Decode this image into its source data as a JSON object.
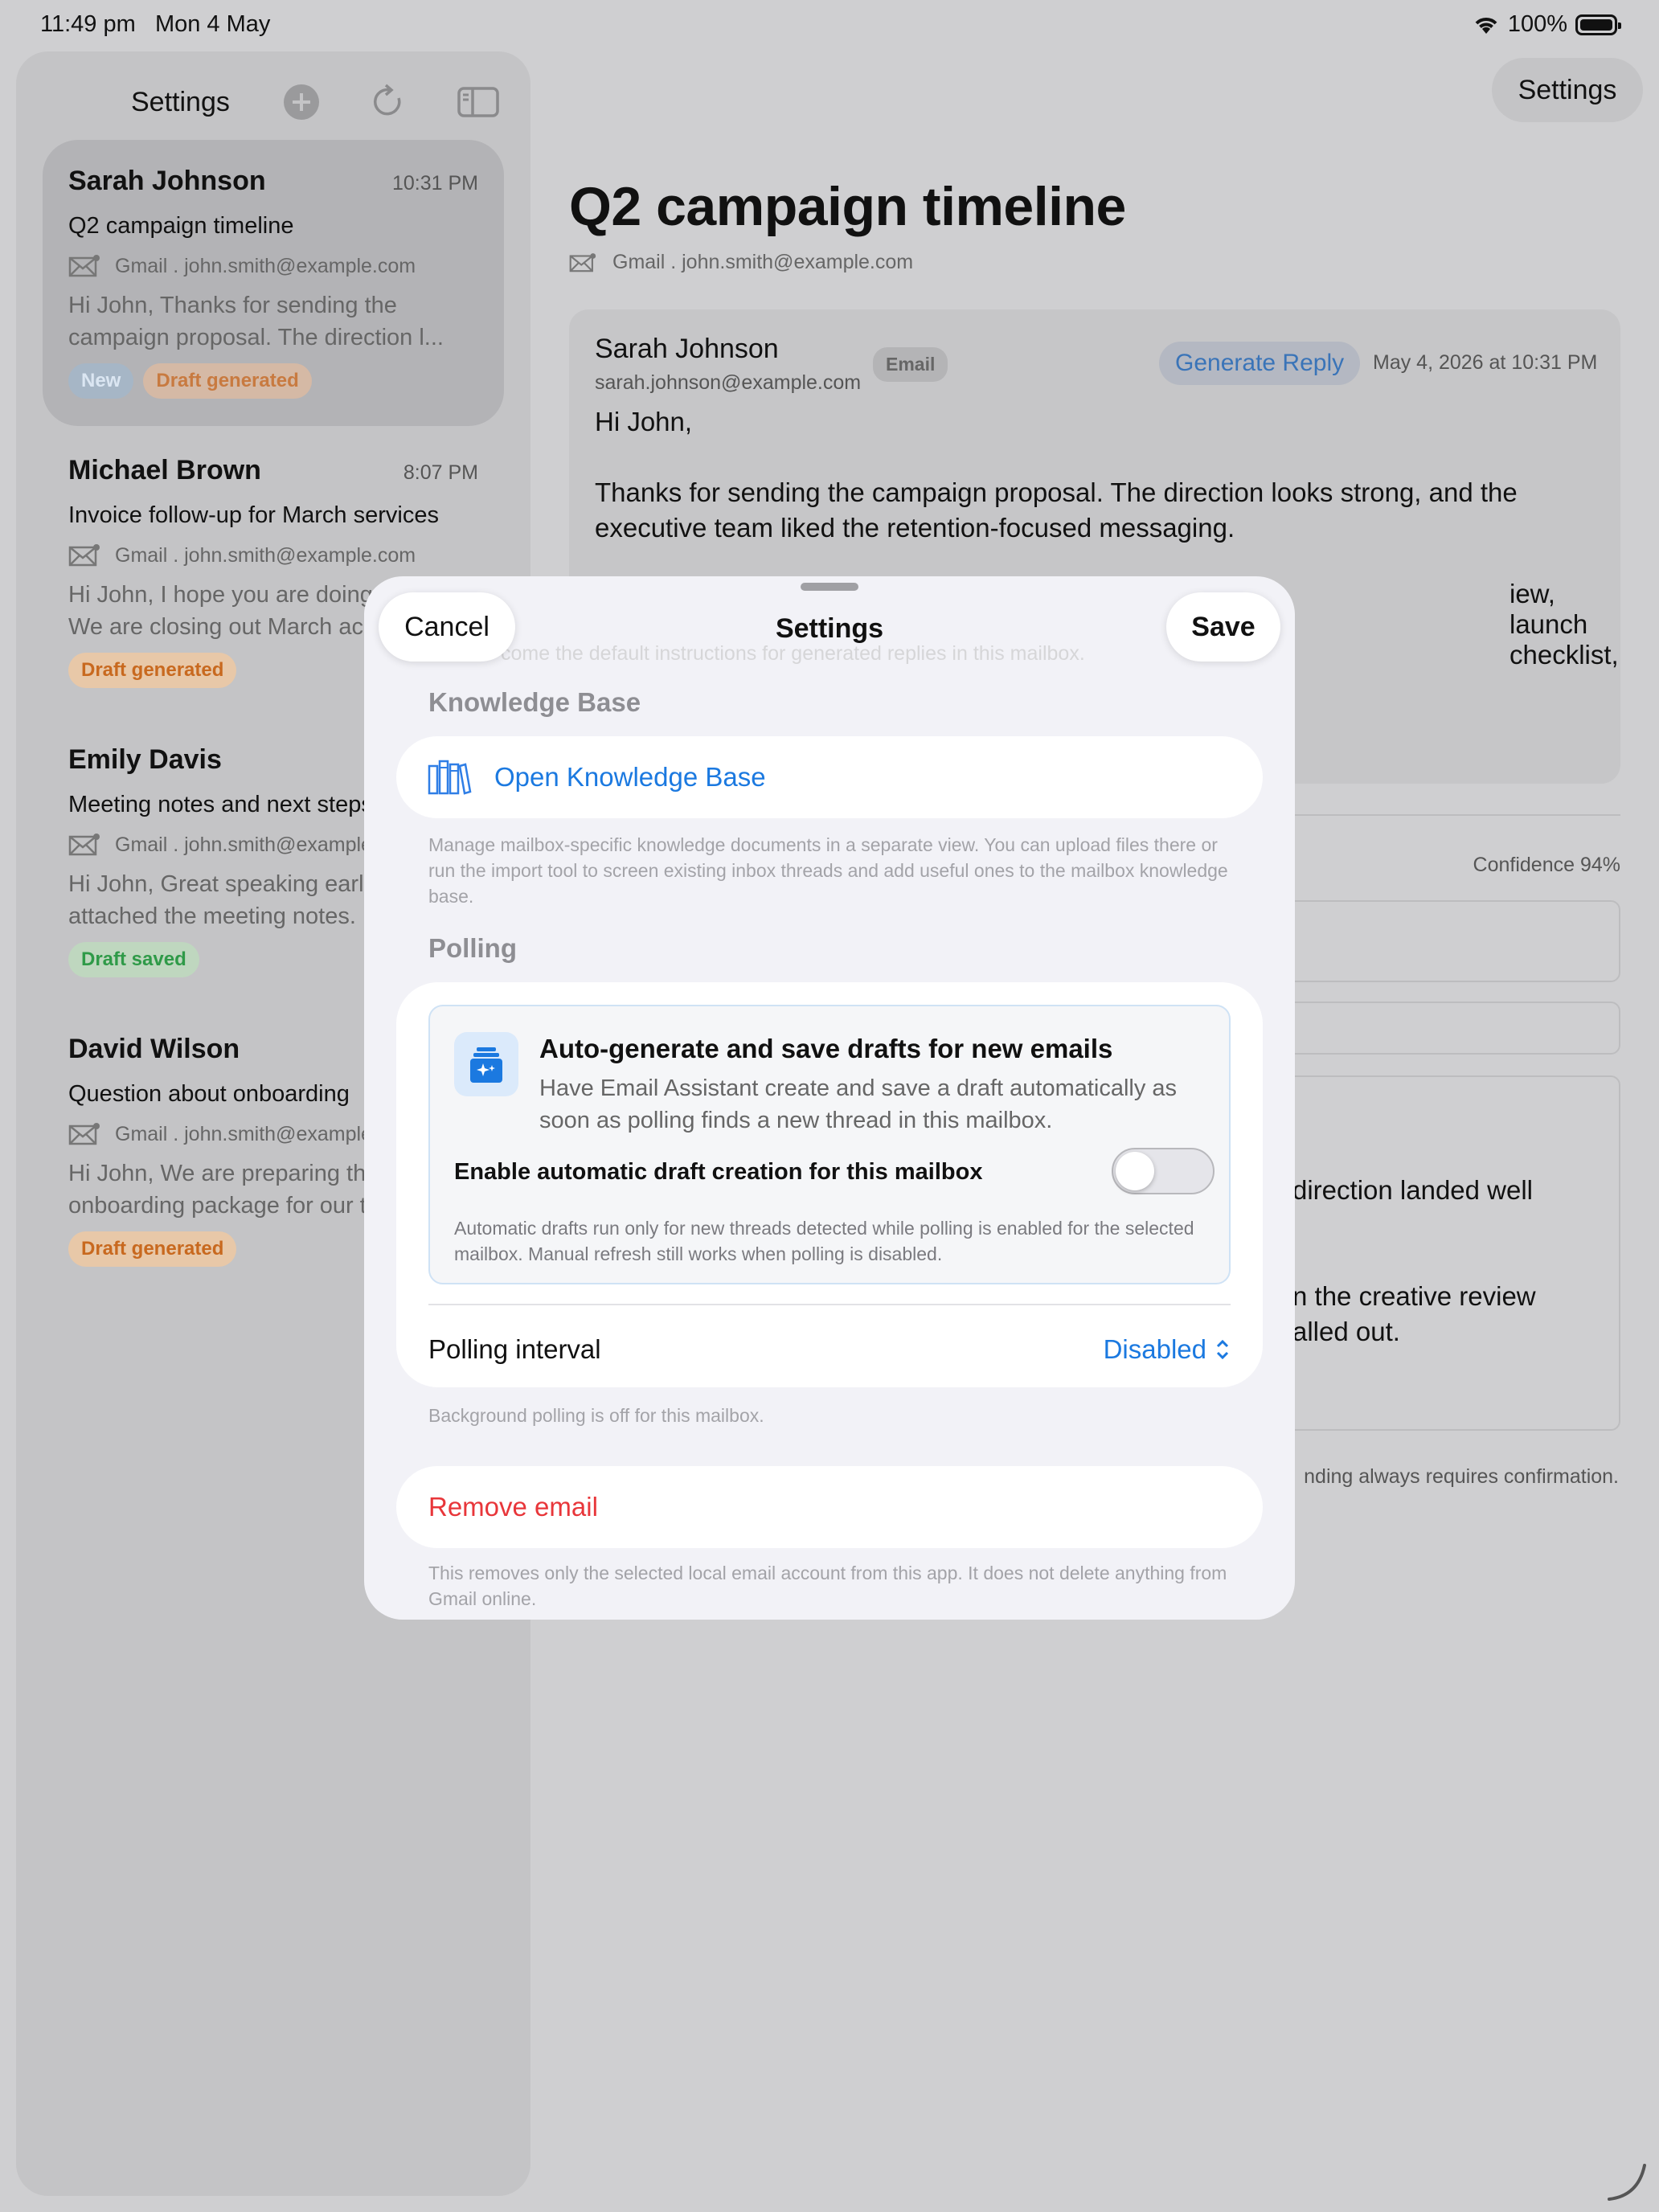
{
  "status": {
    "time": "11:49 pm",
    "date": "Mon 4 May",
    "battery": "100%"
  },
  "sidebar": {
    "title": "Settings",
    "emails": [
      {
        "sender": "Sarah Johnson",
        "time": "10:31 PM",
        "subject": "Q2 campaign timeline",
        "account": "Gmail . john.smith@example.com",
        "preview_1": "Hi John,  Thanks for sending the",
        "preview_2": "campaign proposal. The direction l...",
        "badges": [
          "New",
          "Draft generated"
        ]
      },
      {
        "sender": "Michael Brown",
        "time": "8:07 PM",
        "subject": "Invoice follow-up for March services",
        "account": "Gmail . john.smith@example.com",
        "preview_1": "Hi John,  I hope you are doing well.",
        "preview_2": "We are closing out March accounts.",
        "badges": [
          "Draft generated"
        ]
      },
      {
        "sender": "Emily Davis",
        "time": "",
        "subject": "Meeting notes and next steps",
        "account": "Gmail . john.smith@example.com",
        "preview_1": "Hi John,  Great speaking earlier. I have",
        "preview_2": "attached the meeting notes.",
        "badges": [
          "Draft saved"
        ]
      },
      {
        "sender": "David Wilson",
        "time": "",
        "subject": "Question about onboarding",
        "account": "Gmail . john.smith@example.com",
        "preview_1": "Hi John,  We are preparing the",
        "preview_2": "onboarding package for our team.",
        "badges": [
          "Draft generated"
        ]
      }
    ]
  },
  "detail": {
    "settings_button": "Settings",
    "title": "Q2 campaign timeline",
    "account": "Gmail . john.smith@example.com",
    "message": {
      "sender": "Sarah Johnson",
      "email": "sarah.johnson@example.com",
      "tag": "Email",
      "generate_reply": "Generate Reply",
      "date": "May 4, 2026 at 10:31 PM",
      "greeting": "Hi John,",
      "paragraph_1": "Thanks for sending the campaign proposal. The direction looks strong, and the executive team liked the retention-focused messaging.",
      "paragraph_2_tail": "iew, launch checklist,"
    },
    "confidence": "Confidence 94%",
    "draft_fragment_1": "direction landed well",
    "draft_fragment_2": "n the creative review",
    "draft_fragment_3": "alled out.",
    "footnote": "nding always requires confirmation."
  },
  "sheet": {
    "cancel": "Cancel",
    "title": "Settings",
    "save": "Save",
    "ghost_text": "come the default instructions for generated replies in this mailbox.",
    "knowledge_base": {
      "header": "Knowledge Base",
      "open_label": "Open Knowledge Base",
      "footer": "Manage mailbox-specific knowledge documents in a separate view. You can upload files there or run the import tool to screen existing inbox threads and add useful ones to the mailbox knowledge base."
    },
    "polling": {
      "header": "Polling",
      "auto_title": "Auto-generate and save drafts for new emails",
      "auto_desc": "Have Email Assistant create and save a draft automatically as soon as polling finds a new thread in this mailbox.",
      "toggle_label": "Enable automatic draft creation for this mailbox",
      "toggle_on": false,
      "note": "Automatic drafts run only for new threads detected while polling is enabled for the selected mailbox. Manual refresh still works when polling is disabled.",
      "interval_label": "Polling interval",
      "interval_value": "Disabled",
      "footer": "Background polling is off for this mailbox."
    },
    "remove": {
      "label": "Remove email",
      "footer": "This removes only the selected local email account from this app. It does not delete anything from Gmail online."
    }
  },
  "colors": {
    "accent": "#1b79e0",
    "destructive": "#e8363a"
  }
}
